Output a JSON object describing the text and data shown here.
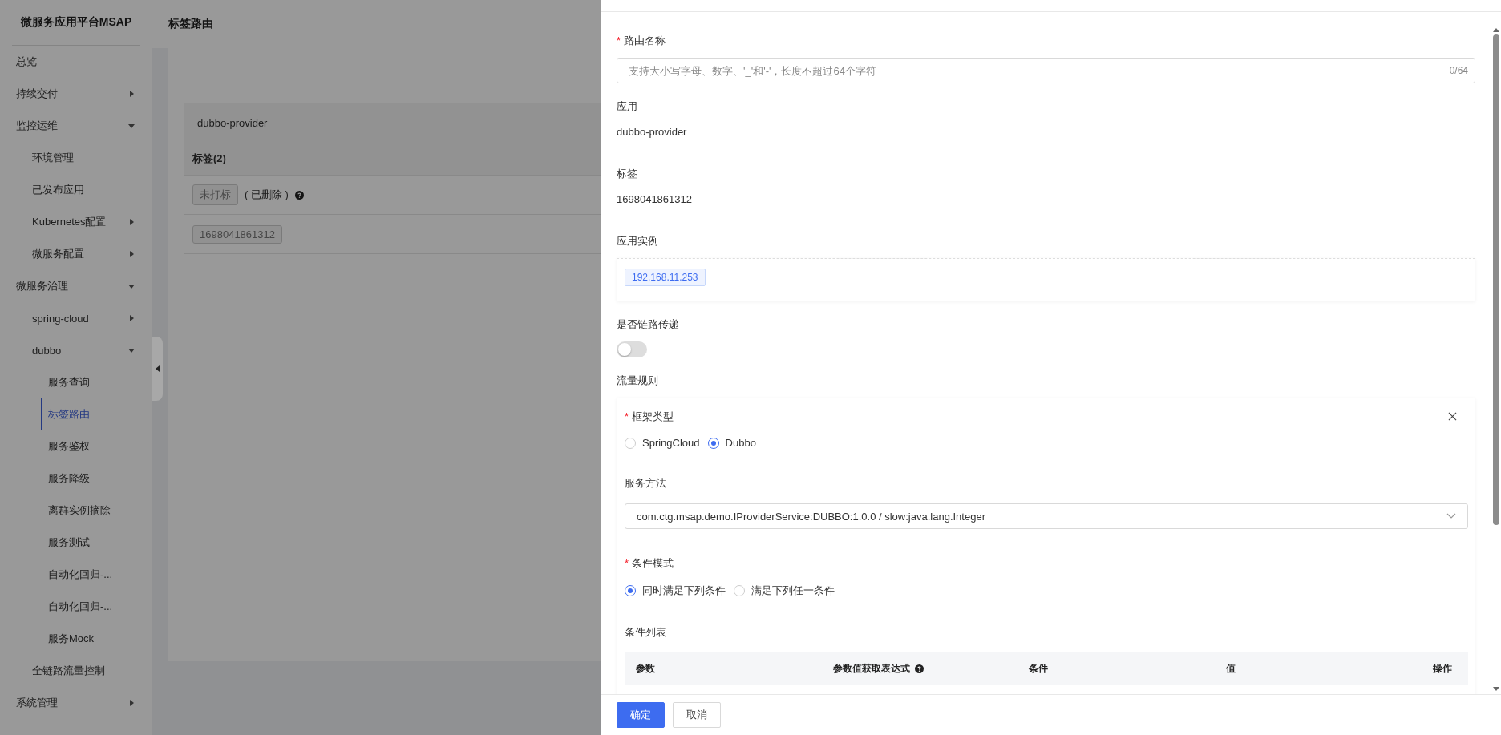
{
  "sidebar": {
    "title": "微服务应用平台MSAP",
    "items": [
      {
        "label": "总览",
        "kind": "link",
        "selected": false
      },
      {
        "label": "持续交付",
        "kind": "group",
        "expanded": false,
        "selected": false
      },
      {
        "label": "监控运维",
        "kind": "group",
        "expanded": true,
        "selected": false,
        "children": [
          {
            "label": "环境管理",
            "kind": "link",
            "selected": false
          },
          {
            "label": "已发布应用",
            "kind": "link",
            "selected": false
          },
          {
            "label": "Kubernetes配置",
            "kind": "group",
            "expanded": false,
            "selected": false
          },
          {
            "label": "微服务配置",
            "kind": "group",
            "expanded": false,
            "selected": false
          }
        ]
      },
      {
        "label": "微服务治理",
        "kind": "group",
        "expanded": true,
        "selected": false,
        "children": [
          {
            "label": "spring-cloud",
            "kind": "group",
            "expanded": false,
            "selected": false
          },
          {
            "label": "dubbo",
            "kind": "group",
            "expanded": true,
            "selected": false,
            "children": [
              {
                "label": "服务查询",
                "kind": "link",
                "selected": false
              },
              {
                "label": "标签路由",
                "kind": "link",
                "selected": true
              },
              {
                "label": "服务鉴权",
                "kind": "link",
                "selected": false
              },
              {
                "label": "服务降级",
                "kind": "link",
                "selected": false
              },
              {
                "label": "离群实例摘除",
                "kind": "link",
                "selected": false
              },
              {
                "label": "服务测试",
                "kind": "link",
                "selected": false
              },
              {
                "label": "自动化回归-...",
                "kind": "link",
                "selected": false
              },
              {
                "label": "自动化回归-...",
                "kind": "link",
                "selected": false
              },
              {
                "label": "服务Mock",
                "kind": "link",
                "selected": false
              }
            ]
          },
          {
            "label": "全链路流量控制",
            "kind": "link",
            "selected": false
          }
        ]
      },
      {
        "label": "系统管理",
        "kind": "group",
        "expanded": false,
        "selected": false
      }
    ]
  },
  "page": {
    "title": "标签路由",
    "app": "dubbo-provider",
    "tags_heading": "标签(2)",
    "tags": [
      {
        "tag": "未打标",
        "note": "( 已删除 )",
        "help": true
      },
      {
        "tag": "1698041861312",
        "help": false
      }
    ]
  },
  "drawer": {
    "route_name": {
      "label": "路由名称",
      "required_mark": "*",
      "placeholder": "支持大小写字母、数字、'_'和'-'，长度不超过64个字符",
      "counter": "0/64"
    },
    "app": {
      "label": "应用",
      "value": "dubbo-provider"
    },
    "tag": {
      "label": "标签",
      "value": "1698041861312"
    },
    "instances": {
      "label": "应用实例",
      "items": [
        "192.168.11.253"
      ]
    },
    "trace_pass": {
      "label": "是否链路传递",
      "on": false
    },
    "traffic_rule": {
      "label": "流量规则",
      "framework": {
        "label": "框架类型",
        "required_mark": "*",
        "options": [
          {
            "label": "SpringCloud",
            "selected": false
          },
          {
            "label": "Dubbo",
            "selected": true
          }
        ]
      },
      "method": {
        "label": "服务方法",
        "value": "com.ctg.msap.demo.IProviderService:DUBBO:1.0.0 / slow:java.lang.Integer"
      },
      "mode": {
        "label": "条件模式",
        "required_mark": "*",
        "options": [
          {
            "label": "同时满足下列条件",
            "selected": true
          },
          {
            "label": "满足下列任一条件",
            "selected": false
          }
        ]
      },
      "conditions": {
        "label": "条件列表",
        "columns": [
          {
            "label": "参数",
            "help": false
          },
          {
            "label": "参数值获取表达式",
            "help": true
          },
          {
            "label": "条件",
            "help": false
          },
          {
            "label": "值",
            "help": false
          },
          {
            "label": "操作",
            "help": false
          }
        ]
      }
    },
    "buttons": [
      {
        "label": "确定",
        "kind": "primary"
      },
      {
        "label": "取消",
        "kind": "default"
      }
    ]
  }
}
